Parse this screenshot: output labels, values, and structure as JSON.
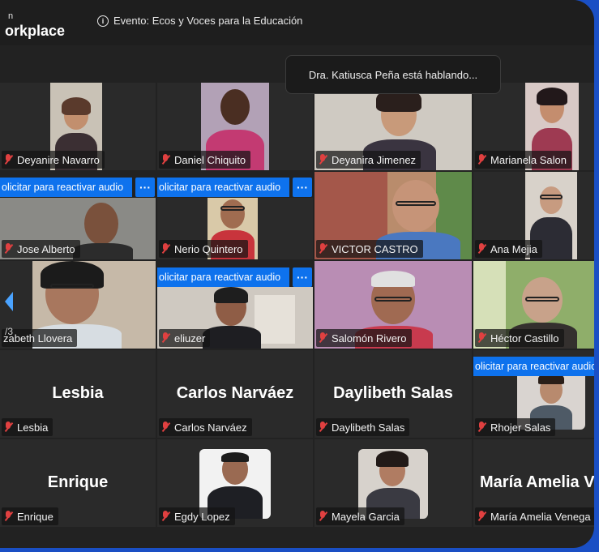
{
  "app": {
    "title_top": "n",
    "title": "orkplace"
  },
  "event": {
    "label": "Evento: Ecos y Voces para la Educación"
  },
  "speaking_notice": "Dra. Katiusca Peña está hablando...",
  "reactivate_label": "olicitar para reactivar audio",
  "reactivate_label_long": "olicitar para reactivar audio",
  "more_label": "···",
  "page_indicator": "/3",
  "participants": {
    "deyanire": "Deyanire Navarro",
    "daniel": "Daniel Chiquito",
    "deyanira": "Deyanira Jimenez",
    "marianela": "Marianela Salon",
    "jose": "Jose Alberto",
    "nerio": "Nerio Quintero",
    "victor": "VICTOR CASTRO",
    "ana": "Ana Mejia",
    "lizabeth": "zabeth Llovera",
    "eliuzer": "eliuzer",
    "salomon": "Salomón Rivero",
    "hector": "Héctor Castillo",
    "lesbia": "Lesbia",
    "carlos": "Carlos Narváez",
    "daylibeth": "Daylibeth Salas",
    "rhojer": "Rhojer Salas",
    "enrique": "Enrique",
    "egdy": "Egdy Lopez",
    "mayela": "Mayela Garcia",
    "maria": "María Amelia Venega"
  },
  "big_names": {
    "lesbia": "Lesbia",
    "carlos": "Carlos Narváez",
    "daylibeth": "Daylibeth Salas",
    "enrique": "Enrique",
    "maria": "María Amelia V"
  },
  "colors": {
    "accent": "#0e72ed",
    "mic_muted": "#e04040",
    "background": "#222222",
    "frame": "#1a4fc4"
  }
}
